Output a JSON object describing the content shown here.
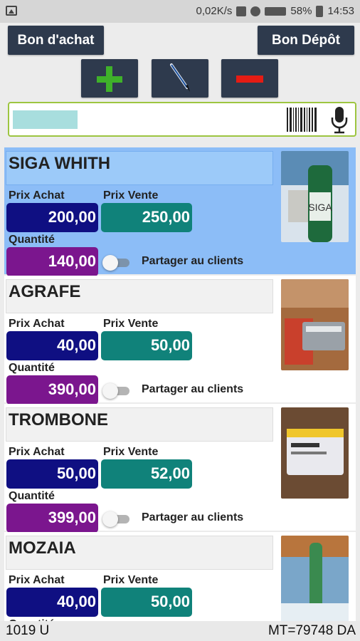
{
  "status_bar": {
    "speed": "0,02K/s",
    "battery": "58%",
    "time": "14:53",
    "icons": [
      "image-icon",
      "mute-icon",
      "alarm-icon",
      "signal-icon",
      "battery-icon"
    ]
  },
  "header": {
    "bon_achat_label": "Bon d'achat",
    "bon_depot_label": "Bon Dépôt"
  },
  "toolbar": {
    "add_icon": "plus-icon",
    "edit_icon": "pen-icon",
    "delete_icon": "minus-icon",
    "add_color": "#3fb12a",
    "delete_color": "#e51c14"
  },
  "search": {
    "value": "",
    "barcode_icon": "barcode-icon",
    "mic_icon": "microphone-icon"
  },
  "labels": {
    "prix_achat": "Prix Achat",
    "prix_vente": "Prix Vente",
    "quantite": "Quantité",
    "share": "Partager au clients"
  },
  "colors": {
    "prix_achat": "#0f0f82",
    "prix_vente": "#10827a",
    "quantite": "#7b168e",
    "selected": "#8cbdf7"
  },
  "products": [
    {
      "name": "SIGA WHITH",
      "prix_achat": "200,00",
      "prix_vente": "250,00",
      "quantite": "140,00",
      "shared": false,
      "selected": true
    },
    {
      "name": "AGRAFE",
      "prix_achat": "40,00",
      "prix_vente": "50,00",
      "quantite": "390,00",
      "shared": false,
      "selected": false
    },
    {
      "name": "TROMBONE",
      "prix_achat": "50,00",
      "prix_vente": "52,00",
      "quantite": "399,00",
      "shared": false,
      "selected": false
    },
    {
      "name": "MOZAIA",
      "prix_achat": "40,00",
      "prix_vente": "50,00",
      "quantite": "",
      "shared": false,
      "selected": false
    }
  ],
  "footer": {
    "units": "1019 U",
    "total": "MT=79748 DA"
  }
}
